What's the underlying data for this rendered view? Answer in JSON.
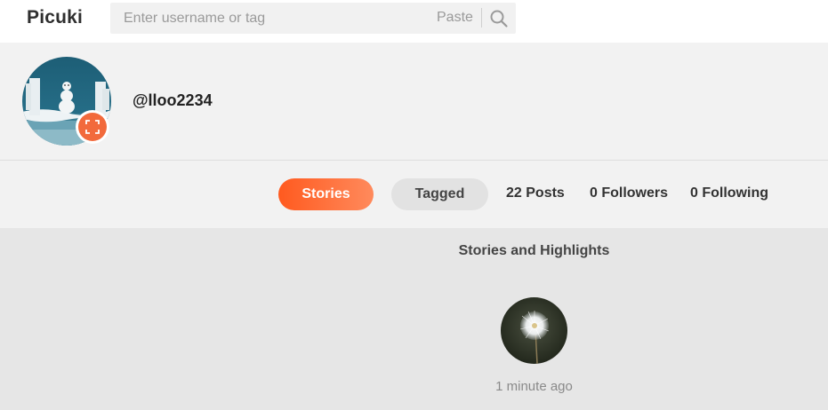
{
  "header": {
    "logo": "Picuki",
    "search_placeholder": "Enter username or tag",
    "paste_label": "Paste",
    "search_icon": "search-icon"
  },
  "profile": {
    "username": "@lloo2234",
    "expand_icon": "expand-icon"
  },
  "tabs": {
    "stories_label": "Stories",
    "tagged_label": "Tagged",
    "posts": "22 Posts",
    "followers": "0 Followers",
    "following": "0 Following"
  },
  "stories_section": {
    "title": "Stories and Highlights",
    "items": [
      {
        "time": "1 minute ago"
      }
    ]
  },
  "colors": {
    "accent": "#ff5a1f",
    "accent_light": "#ff8a5c",
    "header_bg": "#ffffff",
    "page_bg": "#e6e6e6",
    "panel_bg": "#f2f2f2"
  }
}
